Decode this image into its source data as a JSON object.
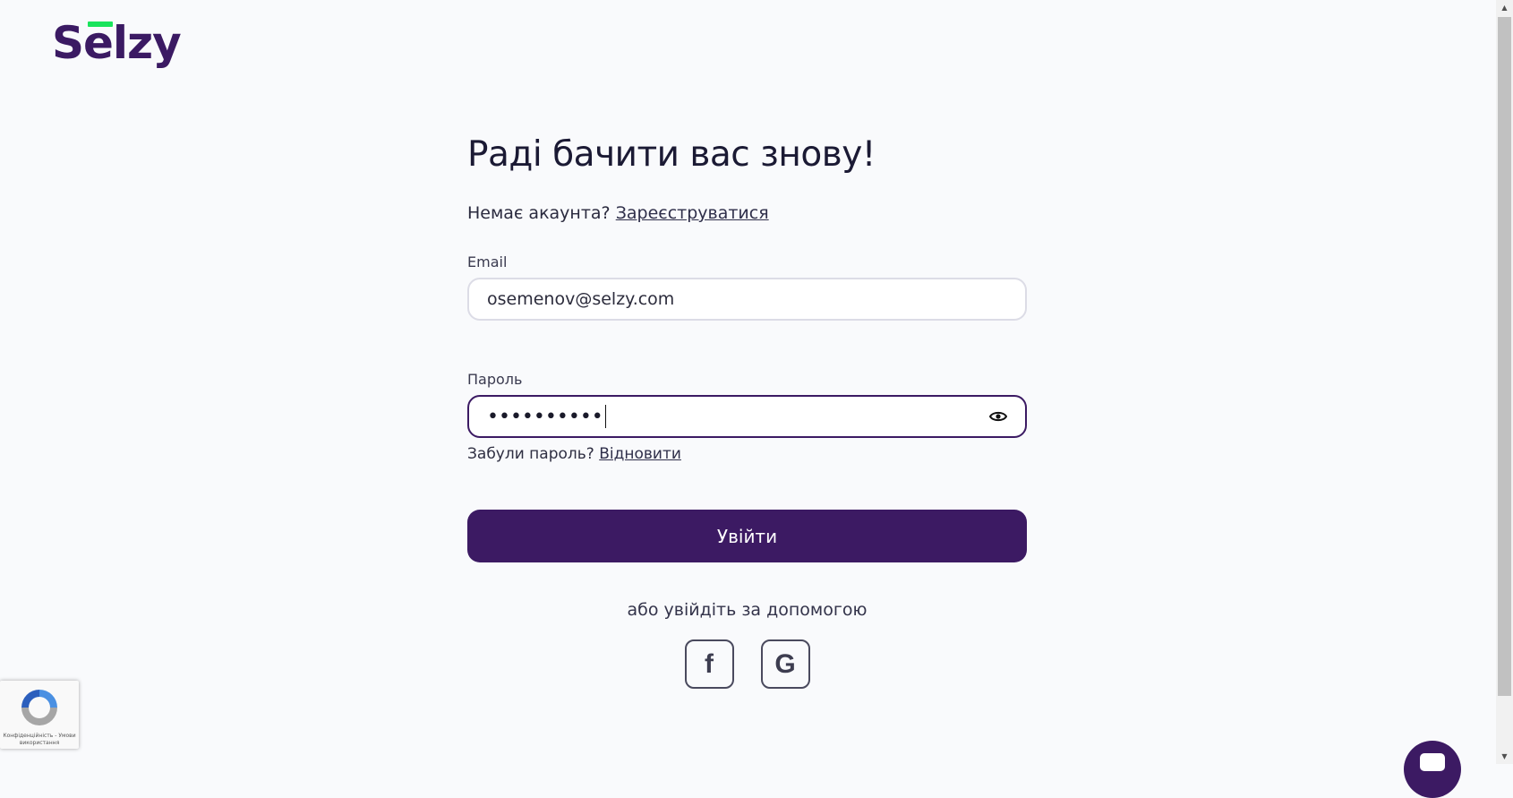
{
  "logo": {
    "text": "Selzy",
    "accent_color": "#1ae45c",
    "brand_color": "#3b1a63"
  },
  "form": {
    "title": "Раді бачити вас знову!",
    "signup_prompt": "Немає акаунта?",
    "signup_link": "Зареєструватися",
    "email_label": "Email",
    "email_value": "osemenov@selzy.com",
    "password_label": "Пароль",
    "password_value": "••••••••••",
    "password_toggle_icon": "eye-icon",
    "forgot_prompt": "Забули пароль?",
    "forgot_link": "Відновити",
    "submit_label": "Увійти",
    "alt_login_text": "або увійдіть за допомогою",
    "social": [
      {
        "icon": "facebook-icon",
        "glyph": "f"
      },
      {
        "icon": "google-icon",
        "glyph": "G"
      }
    ]
  },
  "recaptcha": {
    "icon": "recaptcha-icon",
    "text": "Конфіденційність - Умови використання"
  },
  "chat": {
    "icon": "chat-icon"
  },
  "colors": {
    "primary": "#3c1a63",
    "background": "#f9fafc"
  }
}
